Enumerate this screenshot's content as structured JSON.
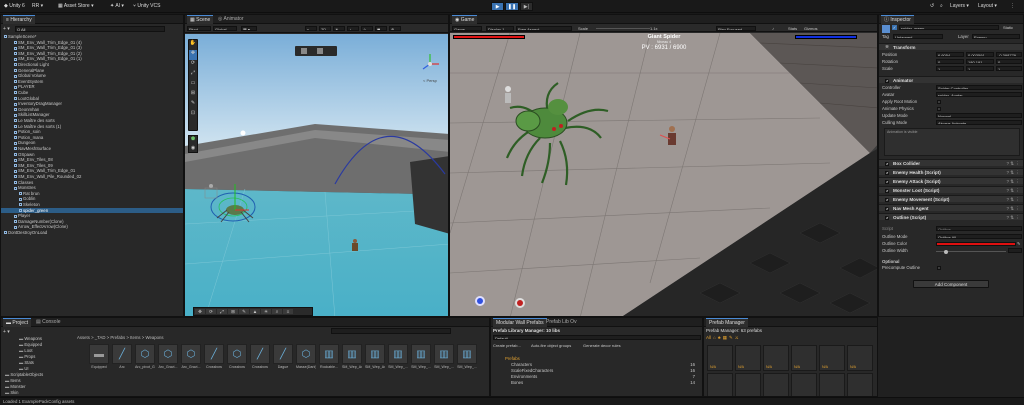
{
  "toolbar": {
    "unity_label": "Unity 6",
    "account": "RR",
    "asset_store": "Asset Store",
    "ai": "AI",
    "vcs": "Unity VCS",
    "layers": "Layers",
    "layout": "Layout"
  },
  "hierarchy": {
    "tab": "Hierarchy",
    "search_placeholder": "Q All",
    "rows": [
      {
        "label": "SampleScene*",
        "indent": 0
      },
      {
        "label": "SM_Env_Wall_Trim_Edge_01 (4)",
        "indent": 2
      },
      {
        "label": "SM_Env_Wall_Trim_Edge_01 (3)",
        "indent": 2
      },
      {
        "label": "SM_Env_Wall_Trim_Edge_01 (2)",
        "indent": 2
      },
      {
        "label": "SM_Env_Wall_Trim_Edge_01 (1)",
        "indent": 2
      },
      {
        "label": "Directional Light",
        "indent": 2
      },
      {
        "label": "GeneralPlane",
        "indent": 2
      },
      {
        "label": "Global Volume",
        "indent": 2
      },
      {
        "label": "EventSystem",
        "indent": 2
      },
      {
        "label": "PLAYER",
        "indent": 2
      },
      {
        "label": "Cube",
        "indent": 2
      },
      {
        "label": "LootGlobal",
        "indent": 2
      },
      {
        "label": "InventoryDragManager",
        "indent": 2
      },
      {
        "label": "Geonmhan",
        "indent": 2
      },
      {
        "label": "SkillListManager",
        "indent": 2
      },
      {
        "label": "Le Maître des sorts",
        "indent": 2
      },
      {
        "label": "Le Maître des sorts (1)",
        "indent": 2
      },
      {
        "label": "Potion_soin",
        "indent": 2
      },
      {
        "label": "Potion_mana",
        "indent": 2
      },
      {
        "label": "Dungeon",
        "indent": 2
      },
      {
        "label": "NavMeshSurface",
        "indent": 2
      },
      {
        "label": "OSpawn",
        "indent": 2
      },
      {
        "label": "SM_Env_Tiles_08",
        "indent": 2
      },
      {
        "label": "SM_Env_Tiles_09",
        "indent": 2
      },
      {
        "label": "SM_Env_Wall_Trim_Edge_01",
        "indent": 2
      },
      {
        "label": "SM_Env_Wall_Pile_Rounded_02",
        "indent": 2
      },
      {
        "label": "Classes",
        "indent": 2
      },
      {
        "label": "Monstres",
        "indent": 2
      },
      {
        "label": "Rat brun",
        "indent": 3
      },
      {
        "label": "Goblin",
        "indent": 3
      },
      {
        "label": "Skeleton",
        "indent": 3
      },
      {
        "label": "spider_green",
        "indent": 3
      },
      {
        "label": "Player",
        "indent": 2
      },
      {
        "label": "DamageNumber(Clone)",
        "indent": 2
      },
      {
        "label": "Arrow_EffectArrow(Clone)",
        "indent": 2
      },
      {
        "label": "DontDestroyOnLoad",
        "indent": 0
      }
    ]
  },
  "scene": {
    "tab_scene": "Scene",
    "tab_animator": "Animator",
    "pivot": "Pivot",
    "global": "Global",
    "persp": "< Persp"
  },
  "game": {
    "tab": "Game",
    "game_mode": "Game",
    "display": "Display 1",
    "aspect": "Free Aspect",
    "scale_label": "Scale",
    "scale_value": "1.1x",
    "play_focused": "Play Focused",
    "stats": "Stats",
    "gizmos": "Gizmos",
    "boss_name": "Giant Spider",
    "boss_sub": "Niveau 4",
    "boss_pv": "PV : 6931 / 6900"
  },
  "inspector": {
    "tab": "Inspector",
    "object_name": "spider_green",
    "static": "Static",
    "tag_label": "Tag",
    "tag_value": "Untagged",
    "layer_label": "Layer",
    "layer_value": "Enemy",
    "transform": {
      "title": "Transform",
      "position": "Position",
      "rotation": "Rotation",
      "scale": "Scale",
      "pos_x": "6.6054",
      "pos_y": "0.003591",
      "pos_z": "-0.398779",
      "rot_x": "0",
      "rot_y": "180.191",
      "rot_z": "0",
      "scl_x": "1",
      "scl_y": "1",
      "scl_z": "1"
    },
    "animator": {
      "title": "Animator",
      "controller_label": "Controller",
      "controller_value": "Spider Controller",
      "avatar_label": "Avatar",
      "avatar_value": "spider_Avatar",
      "root_motion": "Apply Root Motion",
      "physics": "Animate Physics",
      "update_label": "Update Mode",
      "update_value": "Normal",
      "culling_label": "Culling Mode",
      "culling_value": "Always Animate",
      "info": "Animation is visible"
    },
    "components": [
      {
        "label": "Box Collider"
      },
      {
        "label": "Enemy Health (Script)"
      },
      {
        "label": "Enemy Attack (Script)"
      },
      {
        "label": "Monster Loot (Script)"
      },
      {
        "label": "Enemy Movement (Script)"
      },
      {
        "label": "Nav Mesh Agent"
      },
      {
        "label": "Outline (Script)"
      }
    ],
    "outline": {
      "script_label": "Script",
      "script_value": "Outline",
      "mode_label": "Outline Mode",
      "mode_value": "Outline All",
      "color_label": "Outline Color",
      "color": "#e01010",
      "width_label": "Outline Width",
      "width_fraction": 0.12,
      "optional": "Optional",
      "precompute": "Precompute Outline"
    },
    "add_component": "Add Component"
  },
  "project": {
    "tab_project": "Project",
    "tab_console": "Console",
    "tree": [
      "Weapons",
      "Equipped",
      "Loot",
      "Props",
      "Stats",
      "UI",
      "ScriptableObjects",
      "Items",
      "Monster",
      "Skin"
    ],
    "breadcrumb": "Assets > _TAD > Prefabs > Items > Weapons",
    "assets": [
      {
        "label": "Equipped"
      },
      {
        "label": "Arc"
      },
      {
        "label": "Arc_pivot_G..."
      },
      {
        "label": "Arc_Gravi..."
      },
      {
        "label": "Arc_Gravi..."
      },
      {
        "label": "Crossbow"
      },
      {
        "label": "Crossbow"
      },
      {
        "label": "Crossbow"
      },
      {
        "label": "Dague"
      },
      {
        "label": "Masse(Dark)..."
      },
      {
        "label": "Rockable..."
      },
      {
        "label": "SM_Wep_Ax..."
      },
      {
        "label": "SM_Wep_Ax..."
      },
      {
        "label": "SM_Wep_..."
      },
      {
        "label": "SM_Wep_..."
      },
      {
        "label": "SM_Wep_..."
      },
      {
        "label": "SM_Wep_..."
      }
    ],
    "status": "Loaded 1 ExamplePackConfig assets"
  },
  "modular": {
    "tab1": "Modular Wall Prefabs",
    "tab2": "Prefab Lib Ov",
    "title": "Prefab Library Manager: 10 libs",
    "default": "Default",
    "create_prefab": "Create prefab...",
    "autofix": "Auto-fire object groups",
    "generate": "Generate decor rules",
    "tree": [
      {
        "label": "Prefabs",
        "count": ""
      },
      {
        "label": "Characters",
        "count": "16"
      },
      {
        "label": "ScaleFixedCharacters",
        "count": "16"
      },
      {
        "label": "Environments",
        "count": "7"
      },
      {
        "label": "Bones",
        "count": "14"
      }
    ]
  },
  "prefab_manager": {
    "tab": "Prefab Manager",
    "title": "Prefab Manager: 63 prefabs",
    "all": "All",
    "cell_label": "N/A"
  }
}
